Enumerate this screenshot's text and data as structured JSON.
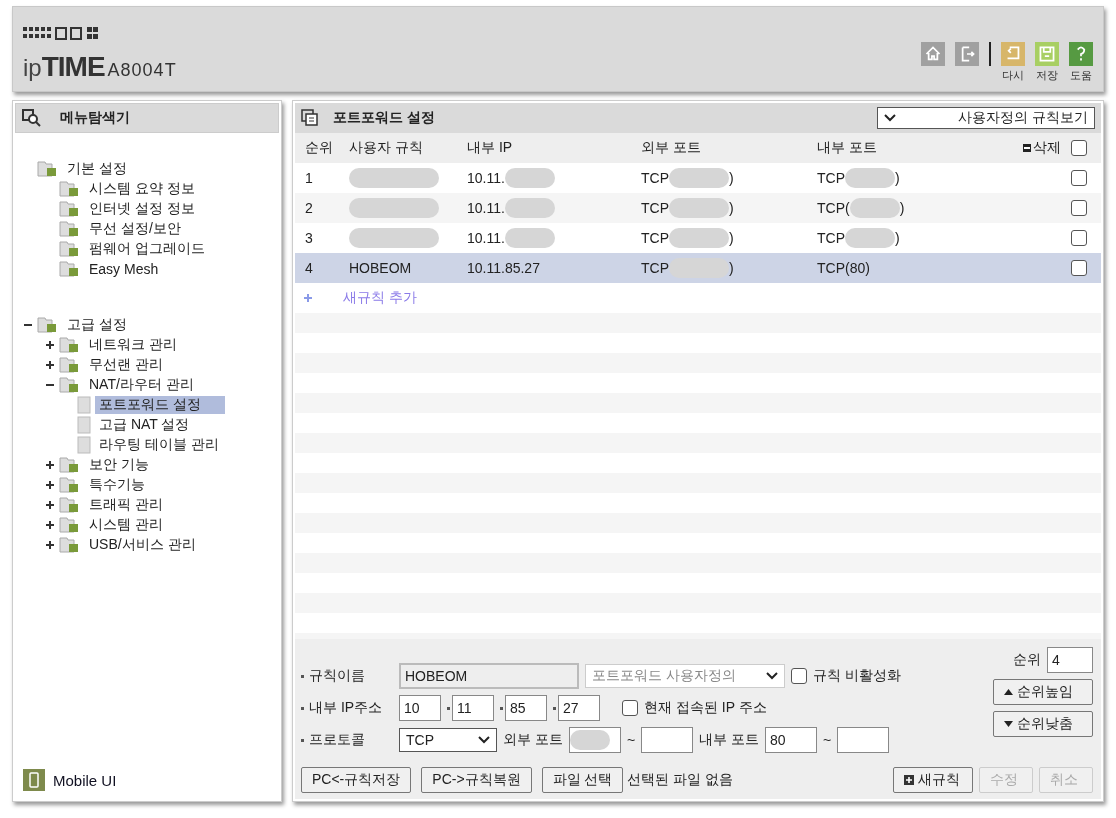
{
  "header": {
    "brand_prefix": "ip",
    "brand_main": "TIME",
    "model": "A8004T",
    "tools": [
      {
        "kind": "home"
      },
      {
        "kind": "logout"
      },
      {
        "kind": "redo",
        "label": "다시"
      },
      {
        "kind": "save",
        "label": "저장"
      },
      {
        "kind": "help",
        "label": "도움"
      }
    ]
  },
  "sidebar": {
    "title": "메뉴탐색기",
    "tree": [
      {
        "label": "기본 설정",
        "selected": false,
        "children": [
          {
            "label": "시스템 요약 정보",
            "selected": false
          },
          {
            "label": "인터넷 설정 정보",
            "selected": false
          },
          {
            "label": "무선 설정/보안",
            "selected": false
          },
          {
            "label": "펌웨어 업그레이드",
            "selected": false
          },
          {
            "label": "Easy Mesh",
            "selected": false
          }
        ]
      },
      {
        "label": "고급 설정",
        "expanded": true,
        "selected": false,
        "children": [
          {
            "label": "네트워크 관리",
            "expanded": false,
            "selected": false
          },
          {
            "label": "무선랜 관리",
            "expanded": false,
            "selected": false
          },
          {
            "label": "NAT/라우터 관리",
            "expanded": true,
            "selected": false,
            "children": [
              {
                "label": "포트포워드 설정",
                "selected": true
              },
              {
                "label": "고급 NAT 설정",
                "selected": false
              },
              {
                "label": "라우팅 테이블 관리",
                "selected": false
              }
            ]
          },
          {
            "label": "보안 기능",
            "expanded": false,
            "selected": false
          },
          {
            "label": "특수기능",
            "expanded": false,
            "selected": false
          },
          {
            "label": "트래픽 관리",
            "expanded": false,
            "selected": false
          },
          {
            "label": "시스템 관리",
            "expanded": false,
            "selected": false
          },
          {
            "label": "USB/서비스 관리",
            "expanded": false,
            "selected": false
          }
        ]
      }
    ],
    "mobile_link": "Mobile UI"
  },
  "panel": {
    "title": "포트포워드 설정",
    "view_select": "사용자정의 규칙보기",
    "table": {
      "columns": [
        "순위",
        "사용자 규칙",
        "내부 IP",
        "외부 포트",
        "내부 포트",
        "삭제"
      ],
      "all_checked": false,
      "rows": [
        {
          "selected": false,
          "checked": false,
          "cells": [
            {
              "text": "1",
              "redacted": false
            },
            {
              "redacted": true
            },
            {
              "text": "10.11.",
              "redacted": true
            },
            {
              "text": "TCP",
              "redacted": true,
              "suffix": ")"
            },
            {
              "text": "TCP",
              "redacted": true,
              "suffix": ")"
            }
          ]
        },
        {
          "selected": false,
          "checked": false,
          "cells": [
            {
              "text": "2",
              "redacted": false
            },
            {
              "redacted": true
            },
            {
              "text": "10.11.",
              "redacted": true
            },
            {
              "text": "TCP",
              "redacted": true,
              "suffix": ")"
            },
            {
              "text": "TCP(",
              "redacted": true,
              "suffix": ")"
            }
          ]
        },
        {
          "selected": false,
          "checked": false,
          "cells": [
            {
              "text": "3",
              "redacted": false
            },
            {
              "redacted": true
            },
            {
              "text": "10.11.",
              "redacted": true
            },
            {
              "text": "TCP",
              "redacted": true,
              "suffix": ")"
            },
            {
              "text": "TCP",
              "redacted": true,
              "suffix": ")"
            }
          ]
        },
        {
          "selected": true,
          "checked": false,
          "cells": [
            {
              "text": "4",
              "redacted": false
            },
            {
              "text": "HOBEOM",
              "redacted": false
            },
            {
              "text": "10.11.85.27",
              "redacted": false
            },
            {
              "text": "TCP",
              "redacted": true,
              "suffix": ")"
            },
            {
              "text": "TCP(80)",
              "redacted": false
            }
          ]
        }
      ],
      "add_rule": "새규칙 추가"
    },
    "form": {
      "rule_name_label": "규칙이름",
      "rule_name": "HOBEOM",
      "type_select": "포트포워드 사용자정의",
      "disable_label": "규칙 비활성화",
      "disable_checked": false,
      "ip_label": "내부 IP주소",
      "ip": [
        "10",
        "11",
        "85",
        "27"
      ],
      "current_ip_label": "현재 접속된 IP 주소",
      "current_ip_checked": false,
      "protocol_label": "프로토콜",
      "protocol": "TCP",
      "ext_port_label": "외부 포트",
      "ext_port_redacted": true,
      "int_port_label": "내부 포트",
      "int_port": "80",
      "tilde": "~",
      "rank_label": "순위",
      "rank": "4",
      "up_button": "순위높임",
      "down_button": "순위낮춤",
      "buttons": [
        {
          "label": "PC<-규칙저장",
          "disabled": false
        },
        {
          "label": "PC->규칙복원",
          "disabled": false
        },
        {
          "label": "파일 선택",
          "disabled": false
        }
      ],
      "file_status": "선택된 파일 없음",
      "actions": [
        {
          "label": "새규칙",
          "disabled": false,
          "plus": true
        },
        {
          "label": "수정",
          "disabled": true,
          "plus": false
        },
        {
          "label": "취소",
          "disabled": true,
          "plus": false
        }
      ]
    }
  }
}
